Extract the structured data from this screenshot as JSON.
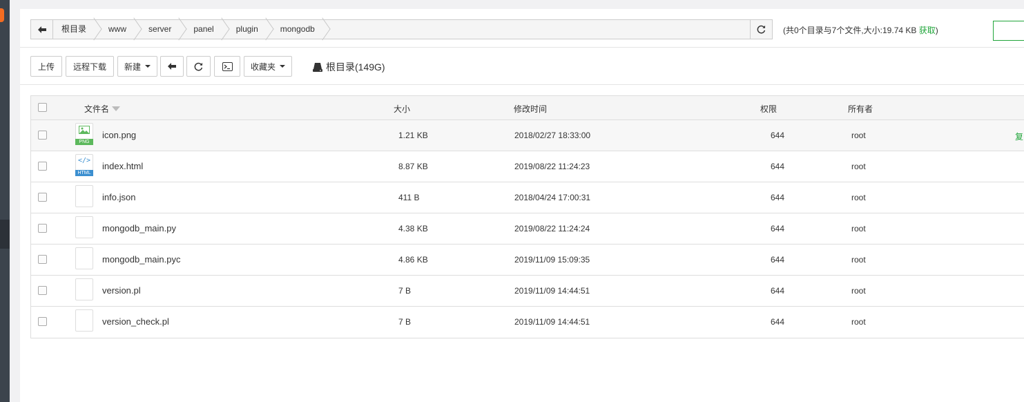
{
  "path": {
    "crumbs": [
      "根目录",
      "www",
      "server",
      "panel",
      "plugin",
      "mongodb"
    ]
  },
  "summary": {
    "text": "(共0个目录与7个文件,大小:19.74 KB",
    "link": "获取",
    "close": ")"
  },
  "toolbar": {
    "upload": "上传",
    "remote_download": "远程下载",
    "new": "新建",
    "favorites": "收藏夹",
    "disk": "根目录(149G)"
  },
  "table": {
    "headers": {
      "name": "文件名",
      "size": "大小",
      "mtime": "修改时间",
      "perm": "权限",
      "owner": "所有者"
    },
    "rows": [
      {
        "icon": "png",
        "name": "icon.png",
        "size": "1.21 KB",
        "mtime": "2018/02/27 18:33:00",
        "perm": "644",
        "owner": "root",
        "op": "复"
      },
      {
        "icon": "html",
        "name": "index.html",
        "size": "8.87 KB",
        "mtime": "2019/08/22 11:24:23",
        "perm": "644",
        "owner": "root",
        "op": ""
      },
      {
        "icon": "file",
        "name": "info.json",
        "size": "411 B",
        "mtime": "2018/04/24 17:00:31",
        "perm": "644",
        "owner": "root",
        "op": ""
      },
      {
        "icon": "file",
        "name": "mongodb_main.py",
        "size": "4.38 KB",
        "mtime": "2019/08/22 11:24:24",
        "perm": "644",
        "owner": "root",
        "op": ""
      },
      {
        "icon": "file",
        "name": "mongodb_main.pyc",
        "size": "4.86 KB",
        "mtime": "2019/11/09 15:09:35",
        "perm": "644",
        "owner": "root",
        "op": ""
      },
      {
        "icon": "file",
        "name": "version.pl",
        "size": "7 B",
        "mtime": "2019/11/09 14:44:51",
        "perm": "644",
        "owner": "root",
        "op": ""
      },
      {
        "icon": "file",
        "name": "version_check.pl",
        "size": "7 B",
        "mtime": "2019/11/09 14:44:51",
        "perm": "644",
        "owner": "root",
        "op": ""
      }
    ],
    "icon_labels": {
      "png": "PNG",
      "html": "HTML"
    }
  },
  "colors": {
    "accent": "#20a53a",
    "sidebar": "#3c444d",
    "brand": "#f36c21"
  }
}
